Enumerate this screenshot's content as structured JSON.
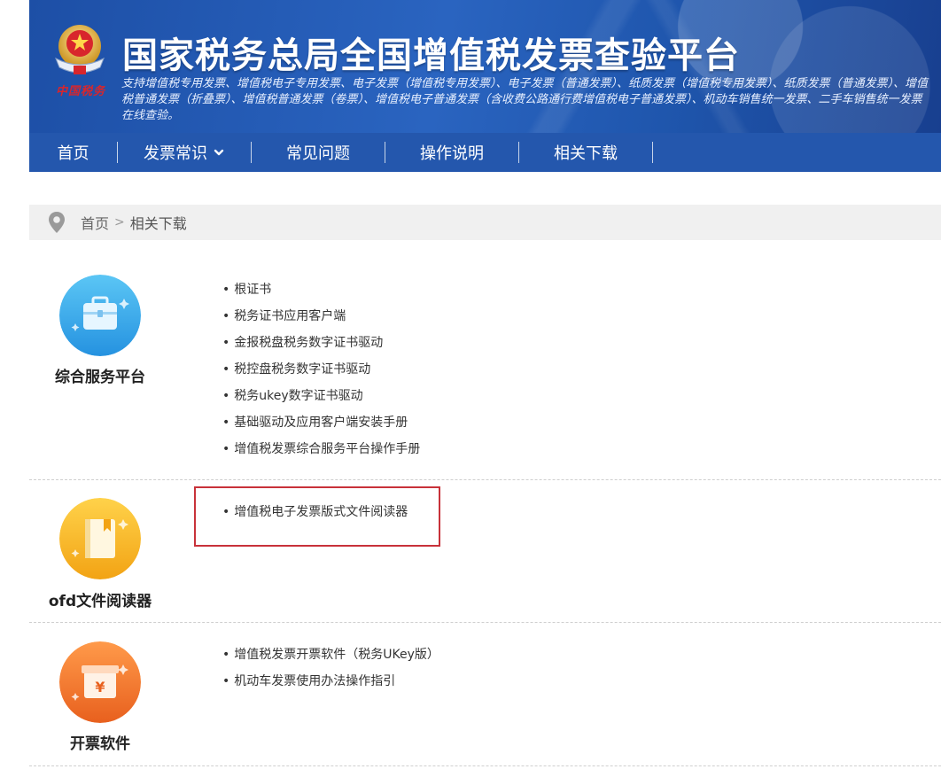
{
  "header": {
    "title": "国家税务总局全国增值税发票查验平台",
    "description": "支持增值税专用发票、增值税电子专用发票、电子发票（增值税专用发票）、电子发票（普通发票）、纸质发票（增值税专用发票）、纸质发票（普通发票）、增值税普通发票（折叠票）、增值税普通发票（卷票）、增值税电子普通发票（含收费公路通行费增值税电子普通发票）、机动车销售统一发票、二手车销售统一发票在线查验。",
    "emblem_text": "中国税务"
  },
  "nav": {
    "items": [
      {
        "label": "首页"
      },
      {
        "label": "发票常识"
      },
      {
        "label": "常见问题"
      },
      {
        "label": "操作说明"
      },
      {
        "label": "相关下载"
      }
    ]
  },
  "breadcrumb": {
    "home": "首页",
    "separator": ">",
    "current": "相关下载"
  },
  "sections": [
    {
      "label": "综合服务平台",
      "icon": "briefcase-icon",
      "color": "#38a8ea",
      "links": [
        "根证书",
        "税务证书应用客户端",
        "金报税盘税务数字证书驱动",
        "税控盘税务数字证书驱动",
        "税务ukey数字证书驱动",
        "基础驱动及应用客户端安装手册",
        "增值税发票综合服务平台操作手册"
      ]
    },
    {
      "label": "ofd文件阅读器",
      "icon": "book-icon",
      "color": "#f5b51e",
      "links": [
        "增值税电子发票版式文件阅读器"
      ]
    },
    {
      "label": "开票软件",
      "icon": "invoice-box-icon",
      "color": "#f0782a",
      "links": [
        "增值税发票开票软件（税务UKey版）",
        "机动车发票使用办法操作指引"
      ]
    }
  ],
  "colors": {
    "banner_blue": "#2457ad",
    "highlight_red": "#c8323a"
  }
}
